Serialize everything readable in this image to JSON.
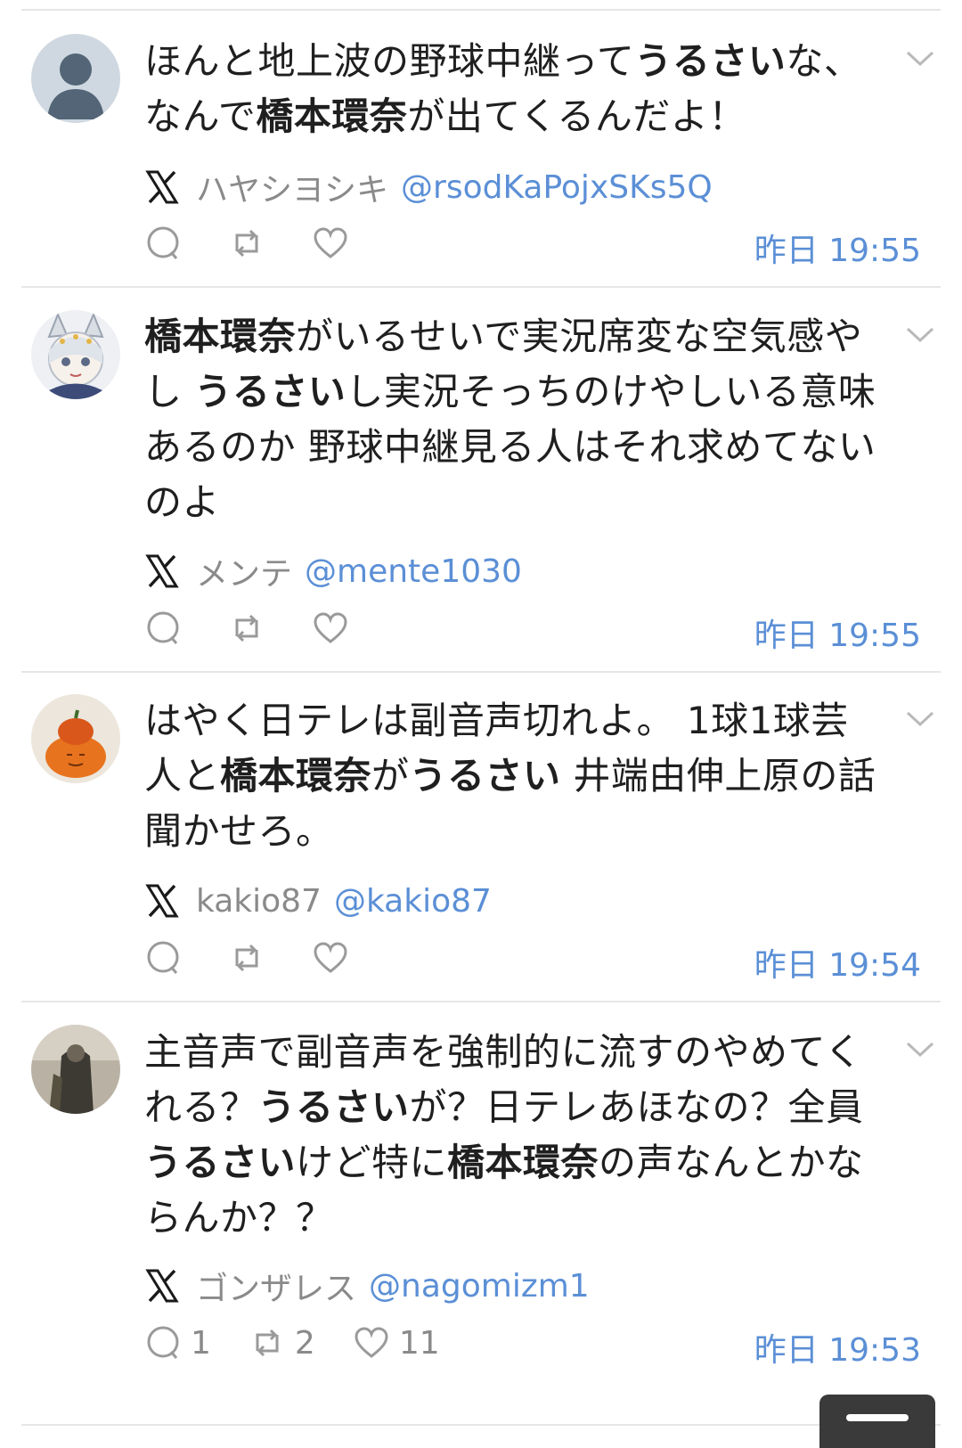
{
  "posts": [
    {
      "segments": [
        {
          "text": "ほんと地上波の野球中継って",
          "bold": false
        },
        {
          "text": "うるさい",
          "bold": true
        },
        {
          "text": "な、なんで",
          "bold": false
        },
        {
          "text": "橋本環奈",
          "bold": true
        },
        {
          "text": "が出てくるんだよ！",
          "bold": false
        }
      ],
      "author_name": "ハヤシヨシキ",
      "handle": "@rsodKaPojxSKs5Q",
      "time": "昨日 19:55",
      "reply_count": "",
      "retweet_count": "",
      "like_count": "",
      "avatar": "default-person-avatar"
    },
    {
      "segments": [
        {
          "text": "橋本環奈",
          "bold": true
        },
        {
          "text": "がいるせいで実況席変な空気感やし ",
          "bold": false
        },
        {
          "text": "うるさい",
          "bold": true
        },
        {
          "text": "し実況そっちのけやしいる意味あるのか 野球中継見る人はそれ求めてないのよ",
          "bold": false
        }
      ],
      "author_name": "メンテ",
      "handle": "@mente1030",
      "time": "昨日 19:55",
      "reply_count": "",
      "retweet_count": "",
      "like_count": "",
      "avatar": "anime-character-avatar"
    },
    {
      "segments": [
        {
          "text": "はやく日テレは副音声切れよ。 1球1球芸人と",
          "bold": false
        },
        {
          "text": "橋本環奈",
          "bold": true
        },
        {
          "text": "が",
          "bold": false
        },
        {
          "text": "うるさい",
          "bold": true
        },
        {
          "text": " 井端由伸上原の話聞かせろ。",
          "bold": false
        }
      ],
      "author_name": "kakio87",
      "handle": "@kakio87",
      "time": "昨日 19:54",
      "reply_count": "",
      "retweet_count": "",
      "like_count": "",
      "avatar": "pumpkin-photo-avatar"
    },
    {
      "segments": [
        {
          "text": "主音声で副音声を強制的に流すのやめてくれる？",
          "bold": false
        },
        {
          "text": "うるさい",
          "bold": true
        },
        {
          "text": "が？日テレあほなの？全員",
          "bold": false
        },
        {
          "text": "うるさい",
          "bold": true
        },
        {
          "text": "けど特に",
          "bold": false
        },
        {
          "text": "橋本環奈",
          "bold": true
        },
        {
          "text": "の声なんとかならんか？？",
          "bold": false
        }
      ],
      "author_name": "ゴンザレス",
      "handle": "@nagomizm1",
      "time": "昨日 19:53",
      "reply_count": "1",
      "retweet_count": "2",
      "like_count": "11",
      "avatar": "dark-photo-avatar"
    }
  ],
  "icons": {
    "source": "x-logo-icon",
    "reply": "reply-bubble-icon",
    "retweet": "retweet-icon",
    "like": "heart-icon",
    "menu": "chevron-down-icon",
    "scroll": "scroll-to-top-icon"
  },
  "colors": {
    "link": "#5b8fd6",
    "muted": "#8a8a8a",
    "text": "#1f1f1f",
    "divider": "#e6e6e6"
  }
}
